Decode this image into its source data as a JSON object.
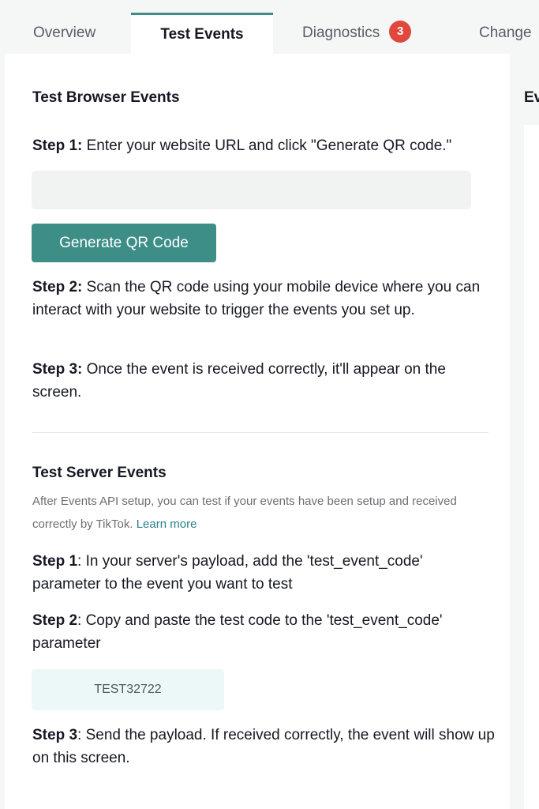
{
  "tabs": [
    {
      "label": "Overview"
    },
    {
      "label": "Test Events"
    },
    {
      "label": "Diagnostics",
      "badge": "3"
    },
    {
      "label": "Change"
    }
  ],
  "side_title": "Ev",
  "browser": {
    "title": "Test Browser Events",
    "step1_label": "Step 1:",
    "step1_text": " Enter your website URL and click \"Generate QR code.\"",
    "url_value": "",
    "button_label": "Generate QR Code",
    "step2_label": "Step 2:",
    "step2_text": " Scan the QR code using your mobile device where you can interact with your website to trigger the events you set up.",
    "step3_label": "Step 3:",
    "step3_text": " Once the event is received correctly, it'll appear on the screen."
  },
  "server": {
    "title": "Test Server Events",
    "desc": "After Events API setup, you can test if your events have been setup and received correctly by TikTok. ",
    "learn_more": "Learn more",
    "step1_label": "Step 1",
    "step1_text": ": In your server's payload, add the 'test_event_code' parameter to the event you want to test",
    "step2_label": "Step 2",
    "step2_text": ": Copy and paste the test code to the 'test_event_code' parameter",
    "test_code": "TEST32722",
    "step3_label": "Step 3",
    "step3_text": ": Send the payload. If received correctly, the event will show up on this screen."
  },
  "colors": {
    "accent": "#3e8e88",
    "badge": "#e0483e",
    "link": "#2a7f8a"
  }
}
